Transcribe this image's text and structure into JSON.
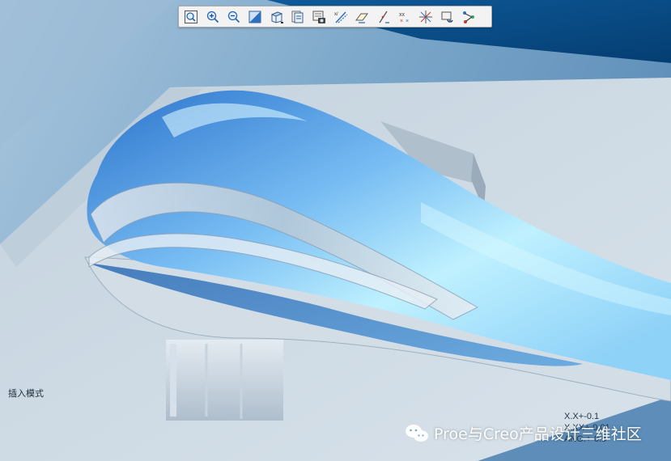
{
  "toolbar": {
    "buttons": [
      {
        "icon": "zoom-fit-icon"
      },
      {
        "icon": "zoom-in-icon"
      },
      {
        "icon": "zoom-out-icon"
      },
      {
        "icon": "repaint-icon"
      },
      {
        "icon": "display-style-icon"
      },
      {
        "icon": "saved-views-icon"
      },
      {
        "icon": "view-manager-icon"
      },
      {
        "icon": "datum-planes-icon"
      },
      {
        "icon": "datum-axes-icon"
      },
      {
        "icon": "datum-points-icon"
      },
      {
        "icon": "coordinate-systems-icon"
      },
      {
        "icon": "annotations-icon"
      },
      {
        "icon": "spin-center-icon"
      },
      {
        "icon": "feature-tree-icon"
      }
    ]
  },
  "status": {
    "mode": "插入模式"
  },
  "tolerances": {
    "line1": "X.X+-0.1",
    "line2": "X.XX+-0.01",
    "line3": "ANG.+-0.5"
  },
  "watermark": {
    "text": "Proe与Creo产品设计三维社区"
  },
  "colors": {
    "background_light": "#9fc0da",
    "background_dark": "#0b4d86",
    "shell_blue": "#4a9be6",
    "shell_highlight": "#c9f4ff"
  }
}
